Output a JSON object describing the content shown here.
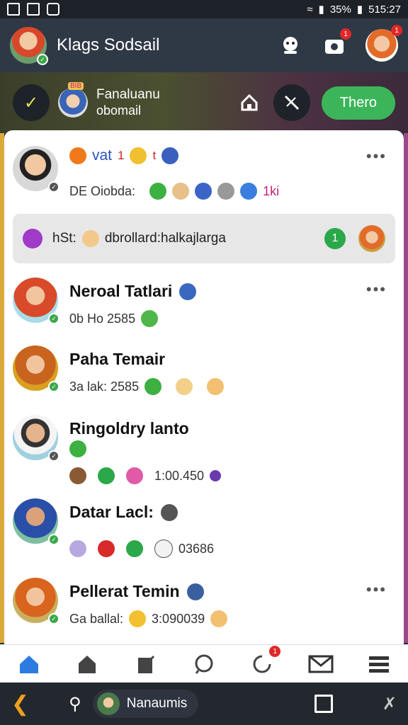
{
  "status": {
    "battery": "35%",
    "time": "515:27"
  },
  "header": {
    "title": "Klags Sodsail",
    "notif_count": "1"
  },
  "banner": {
    "line1": "Fanaluanu",
    "line2": "obomail",
    "badge_text": "BIB",
    "action_label": "Thero"
  },
  "feed": {
    "post1": {
      "head_text": "vat",
      "head_count": "1",
      "head_t": "t",
      "meta_text": "DE Oiobda:",
      "meta_count": "1ki"
    },
    "search": {
      "left": "hSt:",
      "text": "dbrollard:halkajlarga",
      "count": "1"
    },
    "rows": [
      {
        "name": "Neroal Tatlari",
        "meta": "0b Ho 2585"
      },
      {
        "name": "Paha Temair",
        "meta": "3a lak: 2585"
      },
      {
        "name": "Ringoldry lanto",
        "meta": "1:00.450"
      },
      {
        "name": "Datar Lacl:",
        "meta": "03686"
      },
      {
        "name": "Pellerat Temin",
        "meta_prefix": "Ga ballal:",
        "meta": "3:090039"
      }
    ]
  },
  "nav": {
    "notif_count": "1"
  },
  "system": {
    "user": "Nanaumis"
  }
}
